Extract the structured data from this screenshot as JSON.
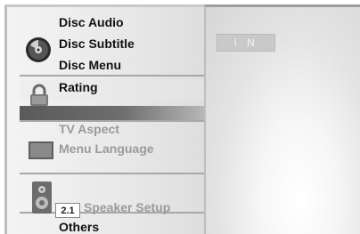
{
  "menu": {
    "disc_audio": "Disc Audio",
    "disc_subtitle": "Disc Subtitle",
    "disc_menu": "Disc Menu",
    "rating": "Rating",
    "tv_aspect": "TV Aspect",
    "menu_language": "Menu Language",
    "speaker_setup": "Speaker Setup",
    "speaker_badge": "2.1",
    "others": "Others"
  },
  "right_panel": {
    "value_box": "I N"
  },
  "icons": {
    "disc": "disc-icon",
    "lock": "lock-icon",
    "tv": "tv-icon",
    "speaker": "speaker-icon"
  }
}
